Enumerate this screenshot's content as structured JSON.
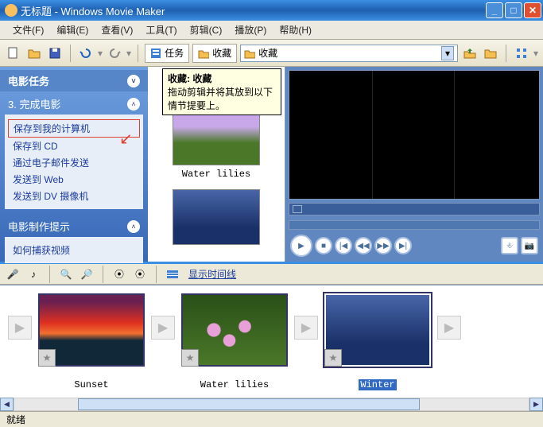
{
  "title": "无标题 - Windows Movie Maker",
  "menu": {
    "file": "文件(F)",
    "edit": "编辑(E)",
    "view": "查看(V)",
    "tools": "工具(T)",
    "clip": "剪辑(C)",
    "play": "播放(P)",
    "help": "帮助(H)"
  },
  "toolbar": {
    "tasks": "任务",
    "collections": "收藏",
    "combo_value": "收藏"
  },
  "tooltip": {
    "title": "收藏: 收藏",
    "body": "拖动剪辑并将其放到以下情节提要上。"
  },
  "taskpane": {
    "header": "电影任务",
    "group3": "3. 完成电影",
    "links": {
      "save_computer": "保存到我的计算机",
      "save_cd": "保存到 CD",
      "send_email": "通过电子邮件发送",
      "send_web": "发送到 Web",
      "send_dv": "发送到 DV 摄像机"
    },
    "tips_header": "电影制作提示",
    "tips_link": "如何捕获视频"
  },
  "collection": {
    "thumb1_label": "Water lilies"
  },
  "timeline": {
    "show": "显示时间线"
  },
  "clips": {
    "c1": "Sunset",
    "c2": "Water lilies",
    "c3": "Winter"
  },
  "status": "就绪"
}
